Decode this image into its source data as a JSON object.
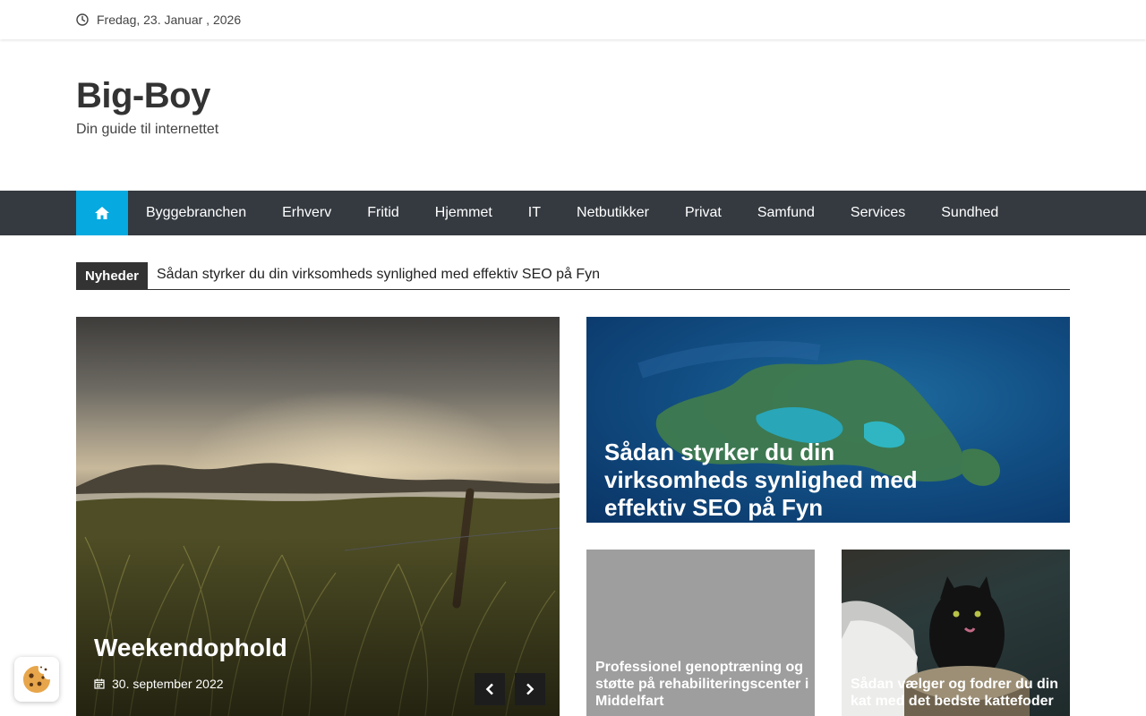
{
  "topbar": {
    "date": "Fredag, 23. Januar , 2026"
  },
  "brand": {
    "title": "Big-Boy",
    "tagline": "Din guide til internettet"
  },
  "nav": {
    "items": [
      {
        "label": "Byggebranchen"
      },
      {
        "label": "Erhverv"
      },
      {
        "label": "Fritid"
      },
      {
        "label": "Hjemmet"
      },
      {
        "label": "IT"
      },
      {
        "label": "Netbutikker"
      },
      {
        "label": "Privat"
      },
      {
        "label": "Samfund"
      },
      {
        "label": "Services"
      },
      {
        "label": "Sundhed"
      }
    ]
  },
  "ticker": {
    "label": "Nyheder",
    "headline": "Sådan styrker du din virksomheds synlighed med effektiv SEO på Fyn"
  },
  "slider": {
    "title": "Weekendophold",
    "date": "30. september 2022"
  },
  "featured": {
    "title": "Sådan styrker du din virksomheds synlighed med effektiv SEO på Fyn"
  },
  "cards": [
    {
      "title": "Professionel genoptræning og støtte på rehabiliteringscenter i Middelfart"
    },
    {
      "title": "Sådan vælger og fodrer du din kat med det bedste kattefoder"
    }
  ],
  "colors": {
    "accent": "#06a9e0",
    "nav_bg": "#343a40",
    "text": "#333333"
  }
}
